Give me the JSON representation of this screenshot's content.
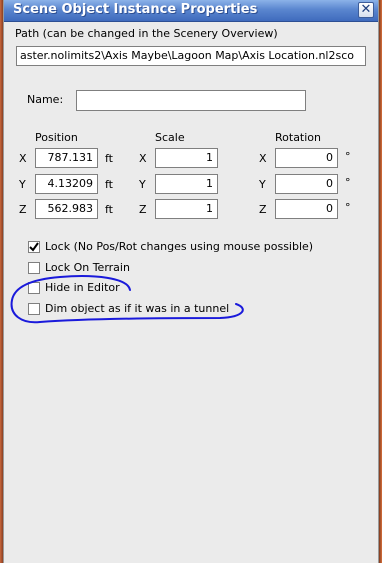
{
  "window": {
    "title": "Scene Object Instance Properties",
    "close_glyph": "✕"
  },
  "path": {
    "label": "Path (can be changed in the Scenery Overview)",
    "value": "aster.nolimits2\\Axis Maybe\\Lagoon Map\\Axis Location.nl2sco"
  },
  "name": {
    "label": "Name:",
    "value": ""
  },
  "headers": {
    "position": "Position",
    "scale": "Scale",
    "rotation": "Rotation"
  },
  "axes": [
    "X",
    "Y",
    "Z"
  ],
  "position": {
    "unit": "ft",
    "values": [
      "787.131",
      "4.13209",
      "562.983"
    ]
  },
  "scale": {
    "values": [
      "1",
      "1",
      "1"
    ]
  },
  "rotation": {
    "unit": "°",
    "values": [
      "0",
      "0",
      "0"
    ]
  },
  "options": [
    {
      "label": "Lock (No Pos/Rot changes using mouse possible)",
      "checked": true
    },
    {
      "label": "Lock On Terrain",
      "checked": false
    },
    {
      "label": "Hide in Editor",
      "checked": false
    },
    {
      "label": "Dim object as if it was in a tunnel",
      "checked": false
    }
  ],
  "annotation": {
    "color": "#1a1adb",
    "shape": "hand-drawn circle around Hide in Editor and Dim object options"
  }
}
